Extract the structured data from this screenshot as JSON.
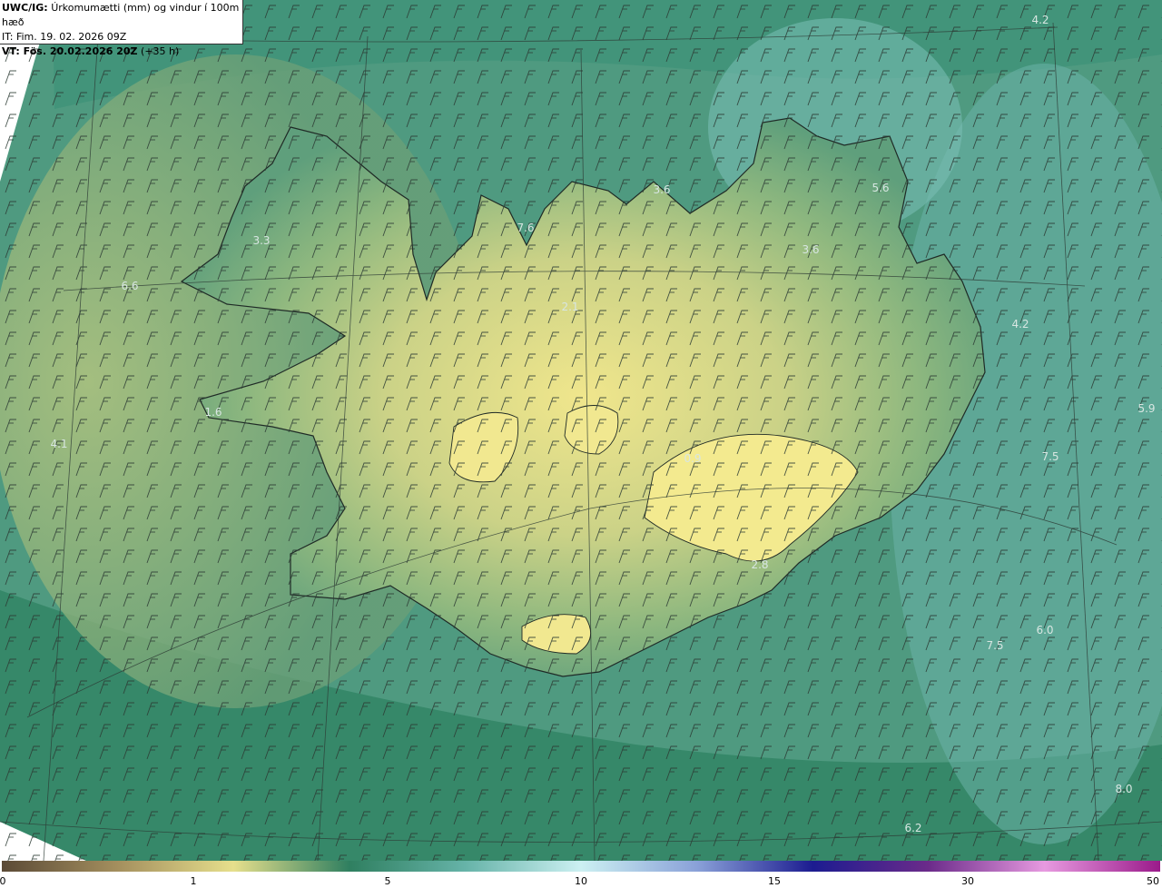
{
  "header": {
    "model": "UWC/IG:",
    "title": "Úrkomumætti (mm) og vindur í 100m hæð",
    "it_line": "IT: Fim. 19. 02. 2026 09Z",
    "vt_label": "VT: Fös. 20.02.2026 20Z",
    "vt_offset": "(+35 h)"
  },
  "value_labels": [
    {
      "text": "4.2"
    },
    {
      "text": "3.6"
    },
    {
      "text": "5.6"
    },
    {
      "text": "7.6"
    },
    {
      "text": "3.6"
    },
    {
      "text": "3.3"
    },
    {
      "text": "6.6"
    },
    {
      "text": "2.1"
    },
    {
      "text": "4.2"
    },
    {
      "text": "5.9"
    },
    {
      "text": "1.6"
    },
    {
      "text": "4.1"
    },
    {
      "text": "0.9"
    },
    {
      "text": "7.5"
    },
    {
      "text": "2.8"
    },
    {
      "text": "6.0"
    },
    {
      "text": "7.5"
    },
    {
      "text": "8.0"
    },
    {
      "text": "6.2"
    }
  ],
  "colorbar": {
    "ticks": [
      "0",
      "1",
      "5",
      "10",
      "15",
      "30",
      "50"
    ],
    "colors": [
      "#5b4a36",
      "#a48f5e",
      "#e6df8c",
      "#2f7f60",
      "#66b3a8",
      "#ccf0f2",
      "#8aa1d8",
      "#1c1c90",
      "#6b2b8a",
      "#e79ae0",
      "#9a1a8a"
    ]
  }
}
